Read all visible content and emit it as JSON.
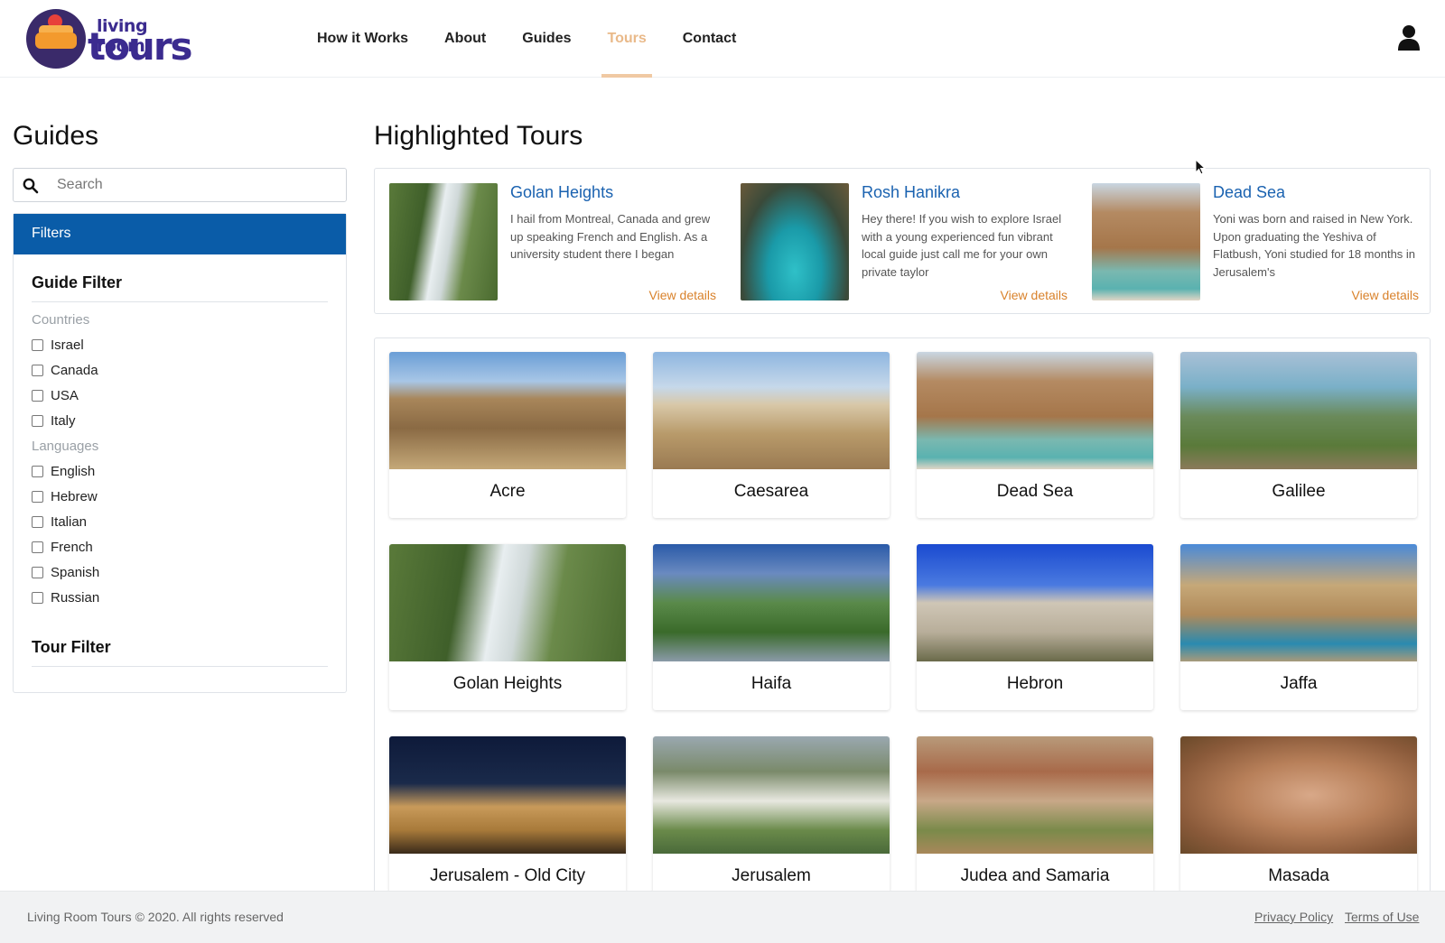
{
  "header": {
    "logo_line1": "living room",
    "logo_line2": "tours",
    "nav": [
      {
        "label": "How it Works",
        "active": false
      },
      {
        "label": "About",
        "active": false
      },
      {
        "label": "Guides",
        "active": false
      },
      {
        "label": "Tours",
        "active": true
      },
      {
        "label": "Contact",
        "active": false
      }
    ],
    "user_icon": "user-icon"
  },
  "sidebar": {
    "title": "Guides",
    "search_placeholder": "Search",
    "search_value": "",
    "filters_label": "Filters",
    "guide_filter_title": "Guide Filter",
    "countries_label": "Countries",
    "countries": [
      "Israel",
      "Canada",
      "USA",
      "Italy"
    ],
    "languages_label": "Languages",
    "languages": [
      "English",
      "Hebrew",
      "Italian",
      "French",
      "Spanish",
      "Russian"
    ],
    "tour_filter_title": "Tour Filter"
  },
  "highlighted": {
    "title": "Highlighted Tours",
    "items": [
      {
        "name": "Golan Heights",
        "description": "I hail from Montreal, Canada and grew up speaking French and English. As a university student there I began",
        "link": "View details"
      },
      {
        "name": "Rosh Hanikra",
        "description": "Hey there! If you wish to explore Israel with a young experienced fun vibrant local guide just call me for your own private taylor",
        "link": "View details"
      },
      {
        "name": "Dead Sea",
        "description": "Yoni was born and raised in New York. Upon graduating the Yeshiva of Flatbush, Yoni studied for 18 months in Jerusalem's",
        "link": "View details"
      }
    ]
  },
  "tours": [
    {
      "name": "Acre"
    },
    {
      "name": "Caesarea"
    },
    {
      "name": "Dead Sea"
    },
    {
      "name": "Galilee"
    },
    {
      "name": "Golan Heights"
    },
    {
      "name": "Haifa"
    },
    {
      "name": "Hebron"
    },
    {
      "name": "Jaffa"
    },
    {
      "name": "Jerusalem - Old City"
    },
    {
      "name": "Jerusalem"
    },
    {
      "name": "Judea and Samaria"
    },
    {
      "name": "Masada"
    }
  ],
  "footer": {
    "copyright": "Living Room Tours © 2020. All rights reserved",
    "privacy": "Privacy Policy",
    "terms": "Terms of Use"
  },
  "colors": {
    "accent_blue": "#0a5ca8",
    "link_blue": "#1a62b0",
    "link_orange": "#d9822b",
    "nav_active": "#e9b989"
  }
}
